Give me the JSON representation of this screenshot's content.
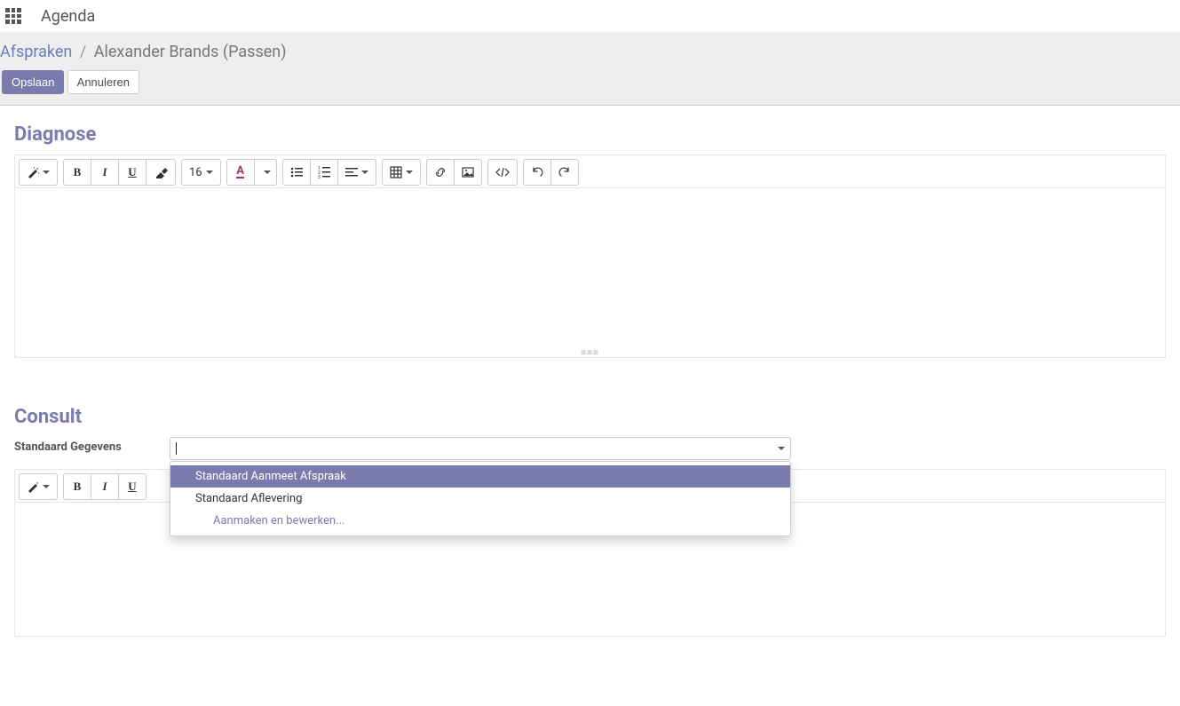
{
  "topbar": {
    "title": "Agenda"
  },
  "breadcrumb": {
    "root": "Afspraken",
    "current": "Alexander Brands (Passen)"
  },
  "buttons": {
    "save": "Opslaan",
    "discard": "Annuleren"
  },
  "sections": {
    "diagnose": {
      "title": "Diagnose"
    },
    "consult": {
      "title": "Consult"
    }
  },
  "editor": {
    "font_size": "16"
  },
  "field": {
    "standaard_gegevens_label": "Standaard Gegevens"
  },
  "dropdown": {
    "options": [
      "Standaard Aanmeet Afspraak",
      "Standaard Aflevering"
    ],
    "create_edit": "Aanmaken en bewerken..."
  }
}
